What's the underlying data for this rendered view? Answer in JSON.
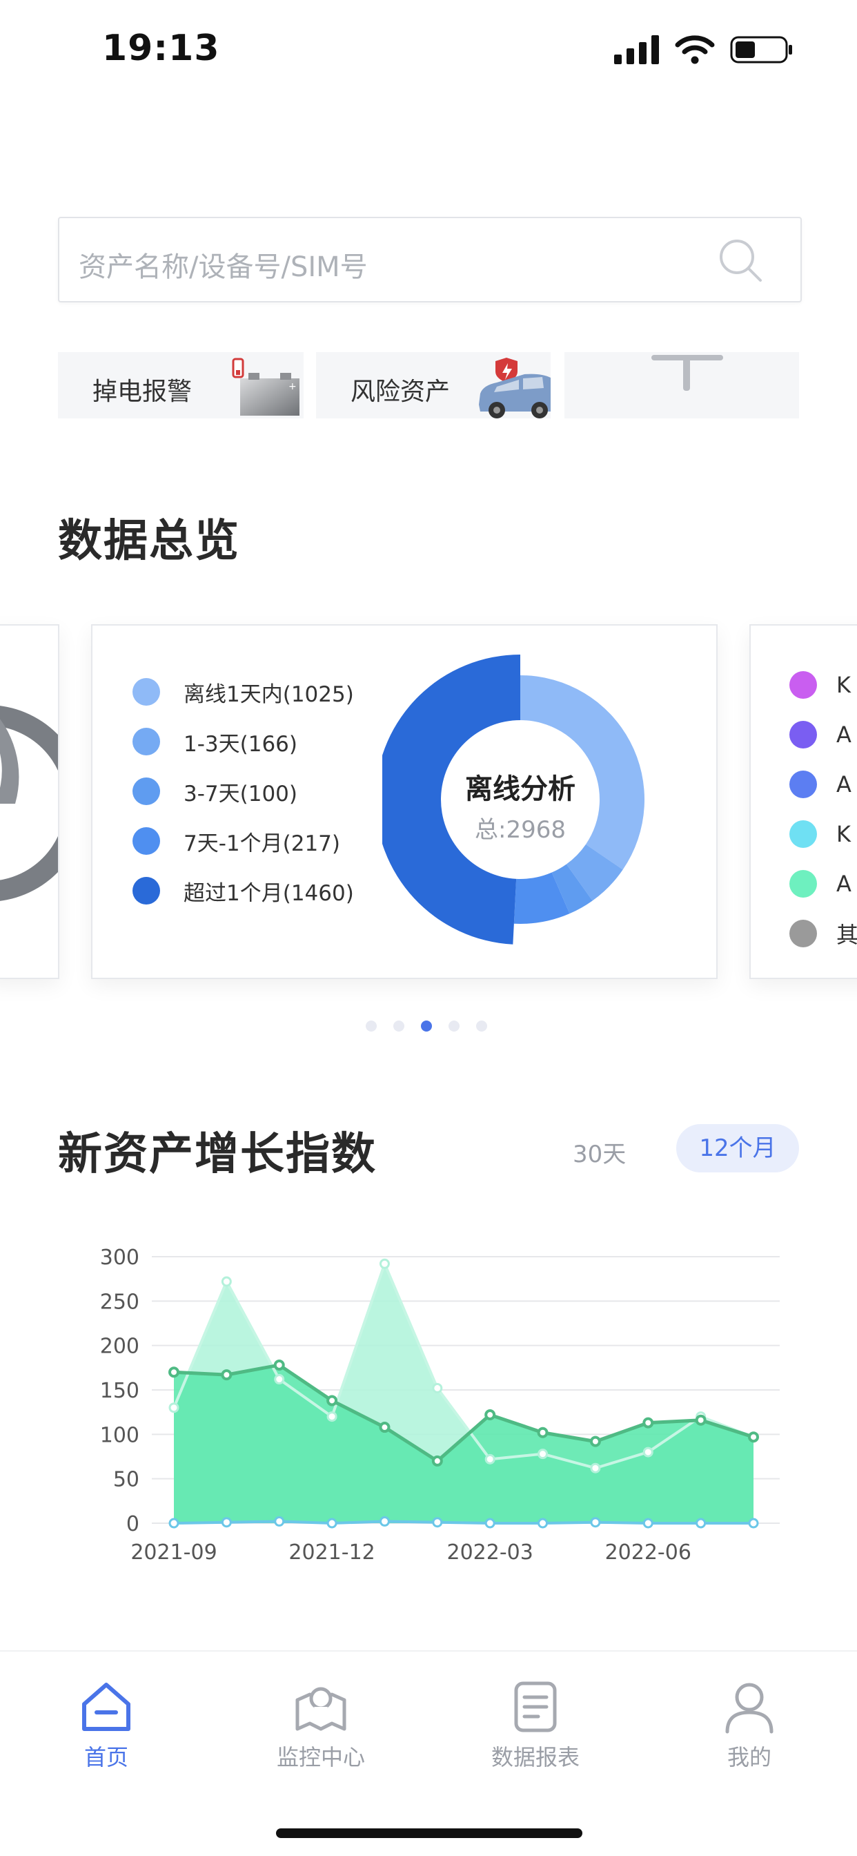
{
  "status_bar": {
    "time": "19:13"
  },
  "search": {
    "placeholder": "资产名称/设备号/SIM号"
  },
  "quick_tiles": [
    {
      "label": "掉电报警",
      "icon": "battery-icon"
    },
    {
      "label": "风险资产",
      "icon": "car-icon"
    },
    {
      "label": "",
      "icon": "plus-icon"
    }
  ],
  "overview": {
    "title": "数据总览",
    "offline_card": {
      "legend": [
        {
          "label": "离线1天内(1025)",
          "value": 1025,
          "color": "#8fbaf7"
        },
        {
          "label": "1-3天(166)",
          "value": 166,
          "color": "#75aaf3"
        },
        {
          "label": "3-7天(100)",
          "value": 100,
          "color": "#5f9cf0"
        },
        {
          "label": "7天-1个月(217)",
          "value": 217,
          "color": "#4f8ff0"
        },
        {
          "label": "超过1个月(1460)",
          "value": 1460,
          "color": "#2a6ad8"
        }
      ],
      "center_title": "离线分析",
      "center_sub": "总:2968"
    },
    "right_card": {
      "legend": [
        {
          "label": "K",
          "color": "#c95ef0"
        },
        {
          "label": "A",
          "color": "#7a5ef2"
        },
        {
          "label": "A",
          "color": "#5c7ef2"
        },
        {
          "label": "K",
          "color": "#6fe0f3"
        },
        {
          "label": "A",
          "color": "#6ef0bf"
        },
        {
          "label": "其",
          "color": "#9a9a9a"
        }
      ]
    },
    "pager": {
      "count": 5,
      "active": 2
    }
  },
  "growth": {
    "title": "新资产增长指数",
    "range_30": "30天",
    "range_12": "12个月"
  },
  "chart_data": {
    "type": "area",
    "x": [
      "2021-09",
      "2021-10",
      "2021-11",
      "2021-12",
      "2022-01",
      "2022-02",
      "2022-03",
      "2022-04",
      "2022-05",
      "2022-06",
      "2022-07",
      "2022-08"
    ],
    "x_tick_labels": [
      "2021-09",
      "2021-12",
      "2022-03",
      "2022-06"
    ],
    "y_ticks": [
      0,
      50,
      100,
      150,
      200,
      250,
      300
    ],
    "ylim": [
      0,
      300
    ],
    "grid": true,
    "series": [
      {
        "values": [
          170,
          167,
          178,
          138,
          108,
          70,
          122,
          102,
          92,
          113,
          116,
          97
        ],
        "color": "#4fba84",
        "fill": "#5ee8ae"
      },
      {
        "values": [
          130,
          272,
          162,
          120,
          292,
          152,
          72,
          78,
          62,
          80,
          120,
          97
        ],
        "color": "#a8f0d2",
        "fill": "#aef3d9"
      },
      {
        "values": [
          0,
          1,
          2,
          0,
          2,
          1,
          0,
          0,
          1,
          0,
          0,
          0
        ],
        "color": "#6bc7e8",
        "fill": "none"
      }
    ]
  },
  "bottom_nav": [
    {
      "label": "首页",
      "icon": "home-icon",
      "active": true
    },
    {
      "label": "监控中心",
      "icon": "map-pin-icon",
      "active": false
    },
    {
      "label": "数据报表",
      "icon": "report-icon",
      "active": false
    },
    {
      "label": "我的",
      "icon": "user-icon",
      "active": false
    }
  ]
}
